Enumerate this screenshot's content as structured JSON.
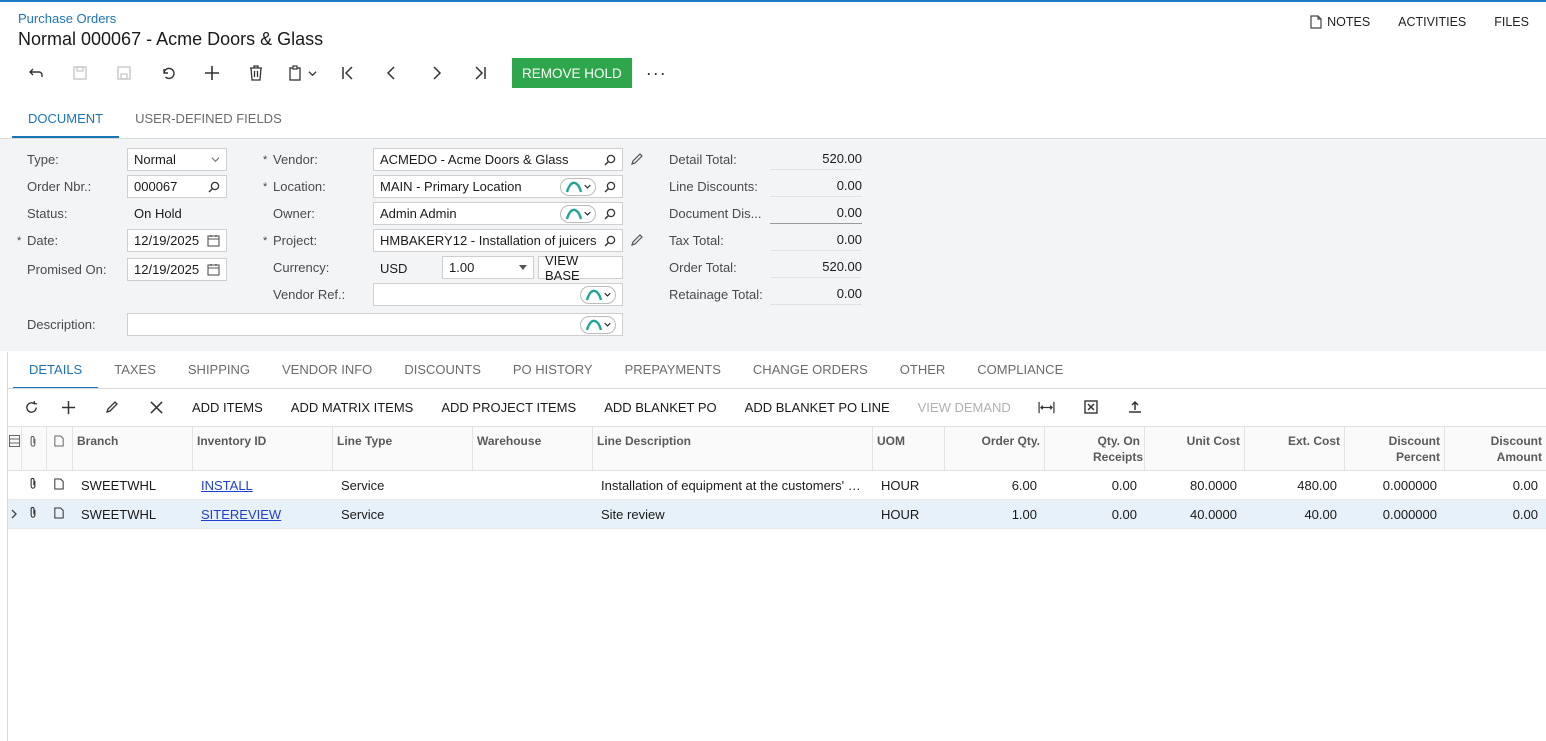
{
  "header": {
    "breadcrumb": "Purchase Orders",
    "title": "Normal 000067 - Acme Doors & Glass",
    "links": {
      "notes": "NOTES",
      "activities": "ACTIVITIES",
      "files": "FILES"
    }
  },
  "toolbar": {
    "remove_hold": "REMOVE HOLD",
    "more": "···"
  },
  "tabs": {
    "document": "DOCUMENT",
    "udf": "USER-DEFINED FIELDS"
  },
  "form": {
    "type_label": "Type:",
    "type_value": "Normal",
    "order_label": "Order Nbr.:",
    "order_value": "000067",
    "status_label": "Status:",
    "status_value": "On Hold",
    "date_label": "Date:",
    "date_value": "12/19/2025",
    "promised_label": "Promised On:",
    "promised_value": "12/19/2025",
    "description_label": "Description:",
    "vendor_label": "Vendor:",
    "vendor_value": "ACMEDO - Acme Doors & Glass",
    "location_label": "Location:",
    "location_value": "MAIN - Primary Location",
    "owner_label": "Owner:",
    "owner_value": "Admin Admin",
    "project_label": "Project:",
    "project_value": "HMBAKERY12 - Installation of juicers",
    "currency_label": "Currency:",
    "currency_value": "USD",
    "rate_value": "1.00",
    "view_base": "VIEW BASE",
    "vendorref_label": "Vendor Ref.:",
    "req": "*"
  },
  "totals": {
    "detail_label": "Detail Total:",
    "detail_value": "520.00",
    "linedisc_label": "Line Discounts:",
    "linedisc_value": "0.00",
    "docdisc_label": "Document Dis...",
    "docdisc_value": "0.00",
    "tax_label": "Tax Total:",
    "tax_value": "0.00",
    "order_label": "Order Total:",
    "order_value": "520.00",
    "retainage_label": "Retainage Total:",
    "retainage_value": "0.00"
  },
  "detail_tabs": [
    "DETAILS",
    "TAXES",
    "SHIPPING",
    "VENDOR INFO",
    "DISCOUNTS",
    "PO HISTORY",
    "PREPAYMENTS",
    "CHANGE ORDERS",
    "OTHER",
    "COMPLIANCE"
  ],
  "grid_toolbar": {
    "add_items": "ADD ITEMS",
    "add_matrix": "ADD MATRIX ITEMS",
    "add_project": "ADD PROJECT ITEMS",
    "add_blanket": "ADD BLANKET PO",
    "add_blanket_line": "ADD BLANKET PO LINE",
    "view_demand": "VIEW DEMAND"
  },
  "grid": {
    "headers": {
      "branch": "Branch",
      "inventory": "Inventory ID",
      "linetype": "Line Type",
      "warehouse": "Warehouse",
      "description": "Line Description",
      "uom": "UOM",
      "qty": "Order Qty.",
      "qty_receipts": "Qty. On Receipts",
      "unit_cost": "Unit Cost",
      "ext_cost": "Ext. Cost",
      "disc_pct": "Discount Percent",
      "disc_amt": "Discount Amount"
    },
    "rows": [
      {
        "branch": "SWEETWHL",
        "inventory": "INSTALL",
        "linetype": "Service",
        "warehouse": "",
        "description": "Installation of equipment at the customers' site",
        "uom": "HOUR",
        "qty": "6.00",
        "qty_receipts": "0.00",
        "unit_cost": "80.0000",
        "ext_cost": "480.00",
        "disc_pct": "0.000000",
        "disc_amt": "0.00"
      },
      {
        "branch": "SWEETWHL",
        "inventory": "SITEREVIEW",
        "linetype": "Service",
        "warehouse": "",
        "description": "Site review",
        "uom": "HOUR",
        "qty": "1.00",
        "qty_receipts": "0.00",
        "unit_cost": "40.0000",
        "ext_cost": "40.00",
        "disc_pct": "0.000000",
        "disc_amt": "0.00"
      }
    ]
  }
}
